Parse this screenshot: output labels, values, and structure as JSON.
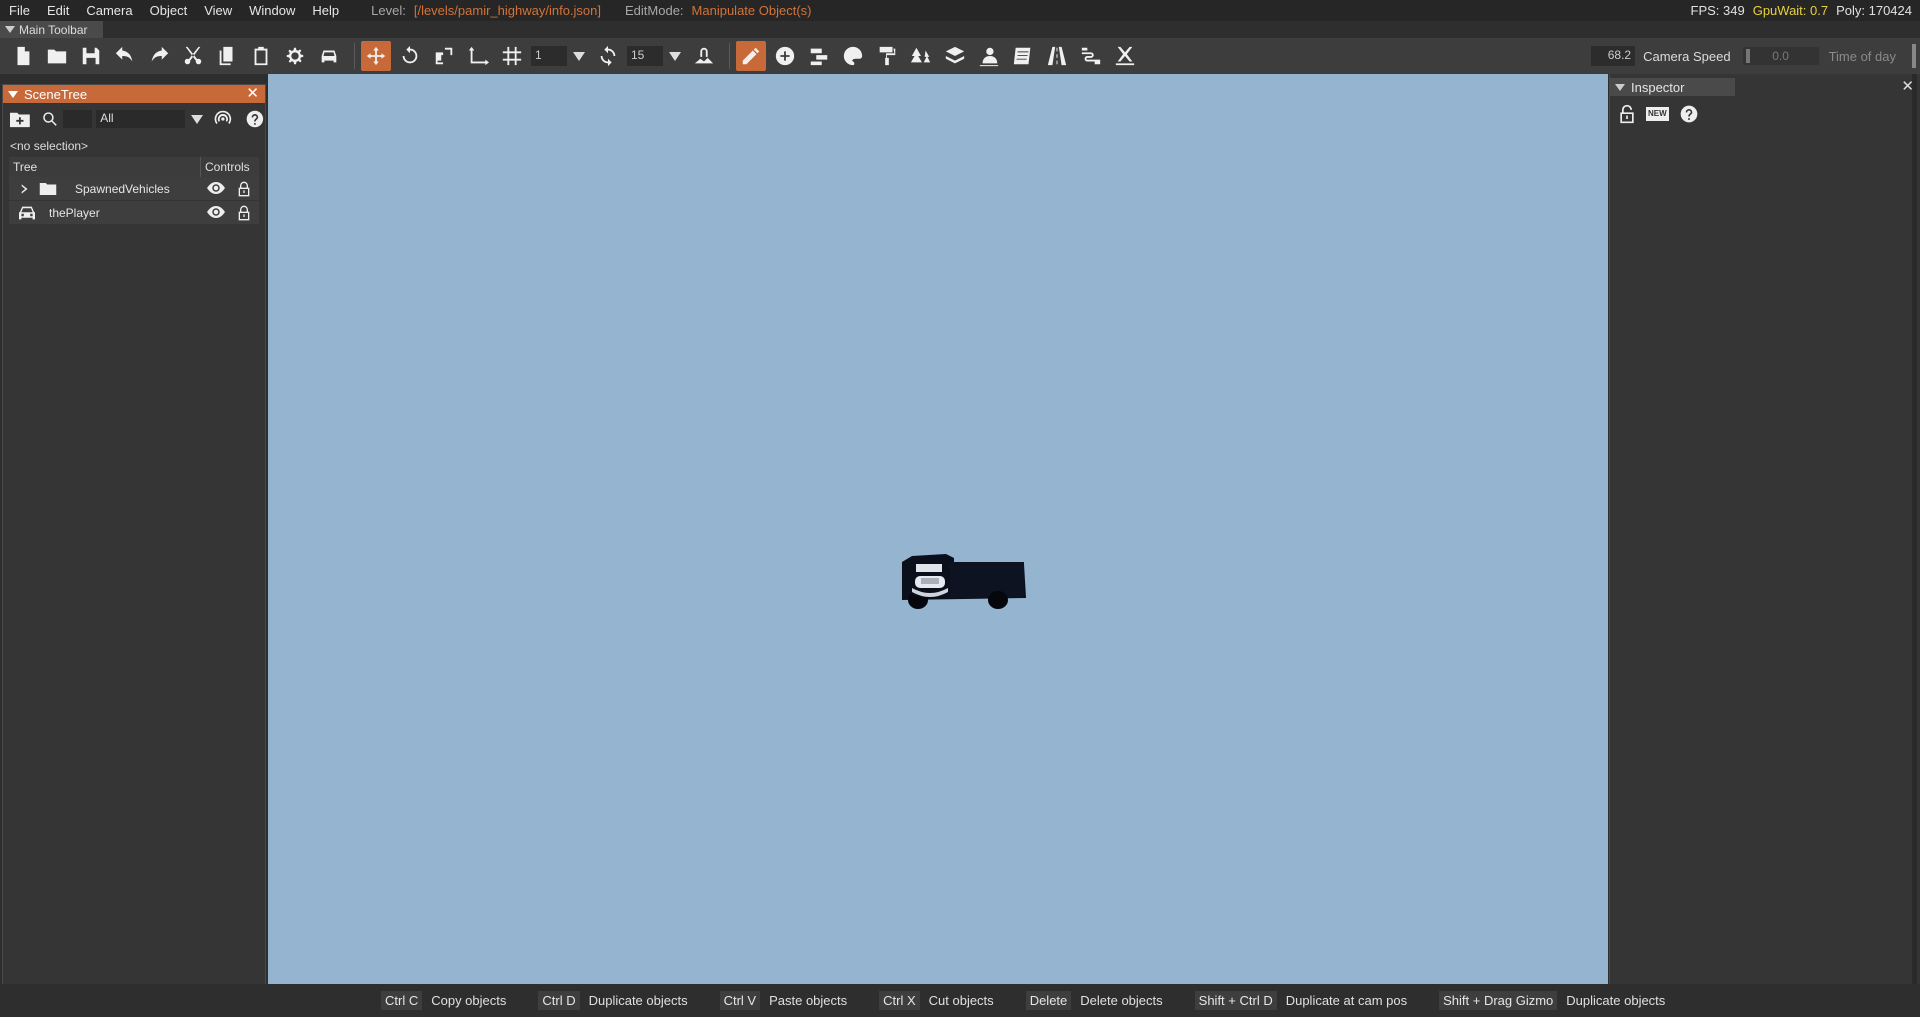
{
  "menubar": {
    "items": [
      "File",
      "Edit",
      "Camera",
      "Object",
      "View",
      "Window",
      "Help"
    ],
    "level_label": "Level:",
    "level_value": "[/levels/pamir_highway/info.json]",
    "editmode_label": "EditMode:",
    "editmode_value": "Manipulate Object(s)",
    "fps": "FPS: 349",
    "gpuwait": "GpuWait: 0.7",
    "poly": "Poly: 170424"
  },
  "main_toolbar": {
    "title": "Main Toolbar",
    "grid_value": "1",
    "rotate_value": "15",
    "camera_speed_value": "68.2",
    "camera_speed_label": "Camera Speed",
    "time_of_day_value": "0.0",
    "time_of_day_label": "Time of day"
  },
  "scenetree": {
    "title": "SceneTree",
    "filter_value": "All",
    "no_selection": "<no selection>",
    "col_tree": "Tree",
    "col_controls": "Controls",
    "rows": [
      {
        "label": "SpawnedVehicles",
        "icon": "folder-icon"
      },
      {
        "label": "thePlayer",
        "icon": "car-icon"
      }
    ]
  },
  "inspector": {
    "title": "Inspector",
    "new_label": "NEW"
  },
  "footer": {
    "hints": [
      {
        "key": "Ctrl C",
        "desc": "Copy objects"
      },
      {
        "key": "Ctrl D",
        "desc": "Duplicate objects"
      },
      {
        "key": "Ctrl V",
        "desc": "Paste objects"
      },
      {
        "key": "Ctrl X",
        "desc": "Cut objects"
      },
      {
        "key": "Delete",
        "desc": "Delete objects"
      },
      {
        "key": "Shift + Ctrl D",
        "desc": "Duplicate at cam pos"
      },
      {
        "key": "Shift + Drag Gizmo",
        "desc": "Duplicate objects"
      }
    ]
  },
  "colors": {
    "accent": "#c8693a",
    "viewport_sky": "#94b4cf",
    "gpuwait": "#e6d23a"
  }
}
